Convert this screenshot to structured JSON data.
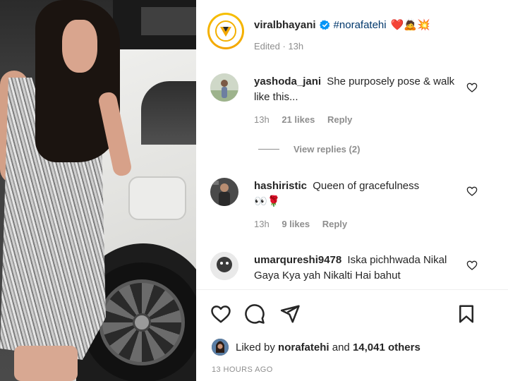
{
  "post": {
    "username": "viralbhayani",
    "verified": true,
    "hashtag": "#norafatehi",
    "emoji": "❤️🙇💥",
    "edited_label": "Edited",
    "time": "13h"
  },
  "comments": [
    {
      "username": "yashoda_jani",
      "text": "She purposely pose & walk like this...",
      "time": "13h",
      "likes": "21 likes",
      "reply": "Reply",
      "view_replies": "View replies (2)"
    },
    {
      "username": "hashiristic",
      "text": "Queen of gracefulness",
      "emoji": "👀🌹",
      "time": "13h",
      "likes": "9 likes",
      "reply": "Reply"
    },
    {
      "username": "umarqureshi9478",
      "text": "Iska pichhwada Nikal Gaya Kya yah Nikalti Hai bahut"
    }
  ],
  "likes": {
    "prefix": "Liked by",
    "user": "norafatehi",
    "middle": "and",
    "count": "14,041 others"
  },
  "timestamp": "13 HOURS AGO",
  "colors": {
    "verified_blue": "#0095f6",
    "link": "#00376b",
    "muted": "#8e8e8e",
    "ring": "#f6c000"
  },
  "icons": [
    "heart-icon",
    "comment-icon",
    "share-icon",
    "bookmark-icon",
    "verified-badge-icon"
  ]
}
